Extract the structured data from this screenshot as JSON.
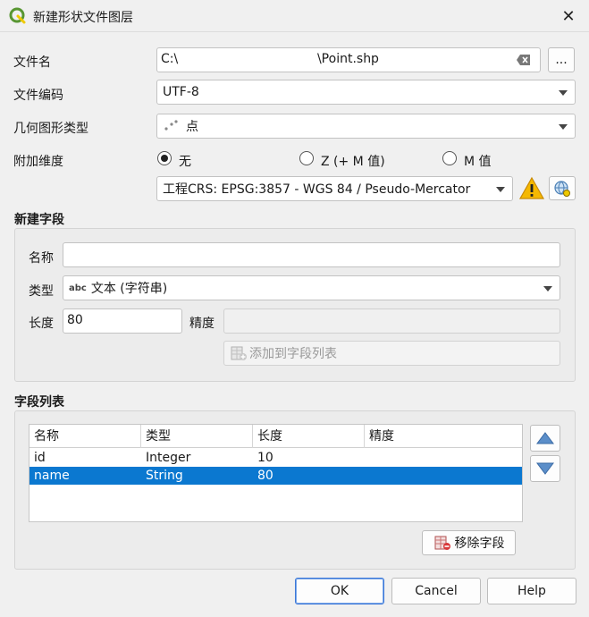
{
  "window": {
    "title": "新建形状文件图层",
    "close_glyph": "✕"
  },
  "file": {
    "label": "文件名",
    "value": "C:\\                                   \\Point.shp",
    "browse_label": "..."
  },
  "encoding": {
    "label": "文件编码",
    "value": "UTF-8"
  },
  "geometry": {
    "label": "几何图形类型",
    "value": "点"
  },
  "dimensions": {
    "label": "附加维度",
    "options": [
      {
        "label": "无",
        "checked": true
      },
      {
        "label": "Z (+ M 值)",
        "checked": false
      },
      {
        "label": "M 值",
        "checked": false
      }
    ]
  },
  "crs": {
    "value": "工程CRS: EPSG:3857 - WGS 84 / Pseudo-Mercator"
  },
  "new_field": {
    "title": "新建字段",
    "name_label": "名称",
    "name_value": "",
    "type_label": "类型",
    "type_value": "文本 (字符串)",
    "type_icon_text": "abc",
    "length_label": "长度",
    "length_value": "80",
    "precision_label": "精度",
    "precision_value": "",
    "add_button": "添加到字段列表"
  },
  "field_list": {
    "title": "字段列表",
    "columns": [
      "名称",
      "类型",
      "长度",
      "精度"
    ],
    "rows": [
      {
        "name": "id",
        "type": "Integer",
        "length": "10",
        "precision": "",
        "selected": false
      },
      {
        "name": "name",
        "type": "String",
        "length": "80",
        "precision": "",
        "selected": true
      }
    ],
    "remove_button": "移除字段"
  },
  "buttons": {
    "ok": "OK",
    "cancel": "Cancel",
    "help": "Help"
  },
  "colors": {
    "selection": "#0b78d0",
    "qgis_green": "#589632",
    "qgis_yellow": "#eec900",
    "warning": "#f5b800"
  }
}
